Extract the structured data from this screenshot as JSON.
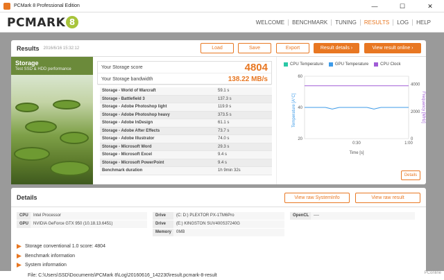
{
  "window": {
    "title": "PCMark 8 Professional Edition",
    "minimize": "—",
    "maximize": "☐",
    "close": "✕"
  },
  "brand": {
    "logo_text": "PCMARK",
    "logo_badge": "8"
  },
  "nav": {
    "items": [
      "WELCOME",
      "BENCHMARK",
      "TUNING",
      "RESULTS",
      "LOG",
      "HELP"
    ],
    "active": "RESULTS"
  },
  "results": {
    "title": "Results",
    "date": "2016/6/16 15:32:12",
    "buttons": {
      "load": "Load",
      "save": "Save",
      "export": "Export",
      "result_details": "Result details ›",
      "view_online": "View result online ›"
    },
    "test": {
      "name": "Storage",
      "subtitle": "Test SSD & HDD performance"
    },
    "score_label": "Your Storage score",
    "score_value": "4804",
    "bandwidth_label": "Your Storage bandwidth",
    "bandwidth_value": "138.22 MB/s",
    "rows": [
      {
        "k": "Storage - World of Warcraft",
        "v": "59.1 s"
      },
      {
        "k": "Storage - Battlefield 3",
        "v": "137.3 s"
      },
      {
        "k": "Storage - Adobe Photoshop light",
        "v": "119.9 s"
      },
      {
        "k": "Storage - Adobe Photoshop heavy",
        "v": "373.5 s"
      },
      {
        "k": "Storage - Adobe InDesign",
        "v": "61.1 s"
      },
      {
        "k": "Storage - Adobe After Effects",
        "v": "73.7 s"
      },
      {
        "k": "Storage - Adobe Illustrator",
        "v": "74.0 s"
      },
      {
        "k": "Storage - Microsoft Word",
        "v": "29.3 s"
      },
      {
        "k": "Storage - Microsoft Excel",
        "v": "9.4 s"
      },
      {
        "k": "Storage - Microsoft PowerPoint",
        "v": "9.4 s"
      },
      {
        "k": "Benchmark duration",
        "v": "1h 9min 32s"
      }
    ]
  },
  "chart_data": {
    "type": "line",
    "series": [
      {
        "name": "CPU Temperature",
        "color": "#2bc8a6"
      },
      {
        "name": "GPU Temperature",
        "color": "#3d9be9",
        "values": [
          40,
          40,
          40,
          40,
          39,
          40,
          40,
          40,
          40,
          40,
          39,
          40,
          40,
          40,
          40,
          40
        ]
      },
      {
        "name": "CPU Clock",
        "color": "#a05bd6",
        "values": [
          3900,
          3900,
          3900,
          3900,
          3900,
          3900,
          3900,
          3900,
          3900,
          3900,
          3900,
          3900,
          3900,
          3900,
          3900,
          3900
        ]
      }
    ],
    "xticks": [
      "0:30",
      "1:00"
    ],
    "xlabel": "Time [s]",
    "ylabel_left": "Temperature [A°C]",
    "ylabel_right": "Frequency [MHz]",
    "yticks_left": [
      "60",
      "40",
      "20"
    ],
    "yticks_right": [
      "4000",
      "2000",
      "0"
    ],
    "ylim_left": [
      20,
      60
    ],
    "ylim_right": [
      0,
      4600
    ]
  },
  "chart_details_button": "Details",
  "details": {
    "title": "Details",
    "view_raw_systeminfo": "View raw SystemInfo",
    "view_raw_result": "View raw result",
    "specs": {
      "cpu_k": "CPU",
      "cpu_v": "Intel Processor",
      "gpu_k": "GPU",
      "gpu_v": "NVIDIA GeForce GTX 950 (10.18.13.6451)",
      "drive1_k": "Drive",
      "drive1_v": "(C: D:) PLEXTOR PX-1TM6Pro",
      "drive2_k": "Drive",
      "drive2_v": "(E:) KINGSTON SUV400S37240G",
      "memory_k": "Memory",
      "memory_v": "0MB",
      "opencl_k": "OpenCL",
      "opencl_v": "----"
    },
    "collapsibles": [
      "Storage conventional 1.0 score: 4804",
      "Benchmark information",
      "System information"
    ]
  },
  "file_path": "File: C:\\Users\\SSD\\Documents\\PCMark 8\\Log\\20160616_142230\\result.pcmark-8-result",
  "watermark": "PConline"
}
